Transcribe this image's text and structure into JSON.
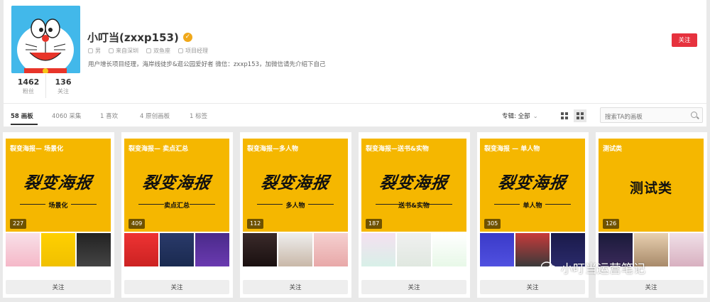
{
  "profile": {
    "name": "小叮当(zxxp153)",
    "verified_icon": "verified-badge-icon",
    "meta": {
      "gender": "男",
      "location": "来自深圳",
      "zodiac": "双鱼座",
      "job": "项目经理"
    },
    "bio": "用户增长项目经理，海岸线徒步&逛公园爱好者 微信：zxxp153，加微信请先介绍下自己",
    "stats": [
      {
        "num": "1462",
        "label": "粉丝"
      },
      {
        "num": "136",
        "label": "关注"
      }
    ],
    "follow_label": "关注",
    "accent": "#e6323e"
  },
  "tabs": [
    {
      "label": "58 画板",
      "active": true
    },
    {
      "label": "4060 采集",
      "active": false
    },
    {
      "label": "1 喜欢",
      "active": false
    },
    {
      "label": "4 原创画板",
      "active": false
    },
    {
      "label": "1 标签",
      "active": false
    }
  ],
  "filter": {
    "label": "专辑: 全部"
  },
  "search": {
    "placeholder": "搜索TA的画板"
  },
  "boards": [
    {
      "title": "裂变海报— 场景化",
      "big": "裂变海报",
      "sub": "场景化",
      "count": "227",
      "follow": "关注"
    },
    {
      "title": "裂变海报— 卖点汇总",
      "big": "裂变海报",
      "sub": "卖点汇总",
      "count": "409",
      "follow": "关注"
    },
    {
      "title": "裂变海报—多人物",
      "big": "裂变海报",
      "sub": "多人物",
      "count": "112",
      "follow": "关注"
    },
    {
      "title": "裂变海报—送书&实物",
      "big": "裂变海报",
      "sub": "送书&实物",
      "count": "187",
      "follow": "关注"
    },
    {
      "title": "裂变海报 — 单人物",
      "big": "裂变海报",
      "sub": "单人物",
      "count": "305",
      "follow": "关注"
    },
    {
      "title": "测试类",
      "big": "测试类",
      "sub": "",
      "count": "126",
      "follow": "关注"
    }
  ],
  "watermark": "小叮当运营笔记"
}
